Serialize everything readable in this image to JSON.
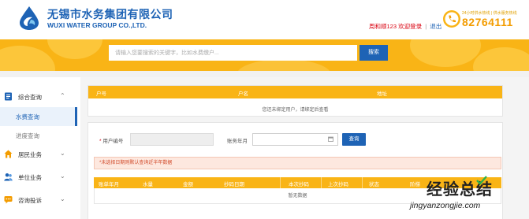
{
  "header": {
    "company_cn": "无锡市水务集团有限公司",
    "company_en": "WUXI WATER GROUP CO.,LTD.",
    "user_name": "周和顺123",
    "welcome": "欢迎登录",
    "separator": "|",
    "logout": "退出",
    "hotline_caption": "24小时供水热线 | 供水服务热线",
    "hotline_number": "82764111"
  },
  "search": {
    "placeholder": "请输入您要搜索的关键字，比如水费缴户...",
    "button": "搜索"
  },
  "sidebar": {
    "items": [
      {
        "label": "综合查询",
        "icon": "document-icon",
        "expanded": true
      },
      {
        "label": "居民业务",
        "icon": "home-icon",
        "expanded": false
      },
      {
        "label": "单位业务",
        "icon": "users-icon",
        "expanded": false
      },
      {
        "label": "咨询投诉",
        "icon": "chat-icon",
        "expanded": false
      }
    ],
    "sub_items": [
      {
        "label": "水费查询",
        "active": true
      },
      {
        "label": "进度查询",
        "active": false
      }
    ]
  },
  "account_table": {
    "columns": [
      "户号",
      "户名",
      "地址"
    ],
    "empty_message": "您还未绑定用户，请绑定后查看"
  },
  "query_form": {
    "user_no_label": "用户编号",
    "user_no_value": "",
    "month_label": "账务年月",
    "month_value": "",
    "query_button": "查询",
    "notice": "*未选择日期则默认查询近半年数据"
  },
  "bill_table": {
    "columns": [
      "账单年月",
      "水量",
      "金额",
      "抄码日期",
      "本次抄码",
      "上次抄码",
      "状态",
      "阶梯"
    ],
    "empty_message": "暂无数据"
  },
  "watermark": {
    "text_cn": "经验总结",
    "url": "jingyanzongjie.com"
  },
  "colors": {
    "brand_blue": "#1e63b5",
    "banner_orange": "#f9b416",
    "alert_red": "#d9000f"
  }
}
